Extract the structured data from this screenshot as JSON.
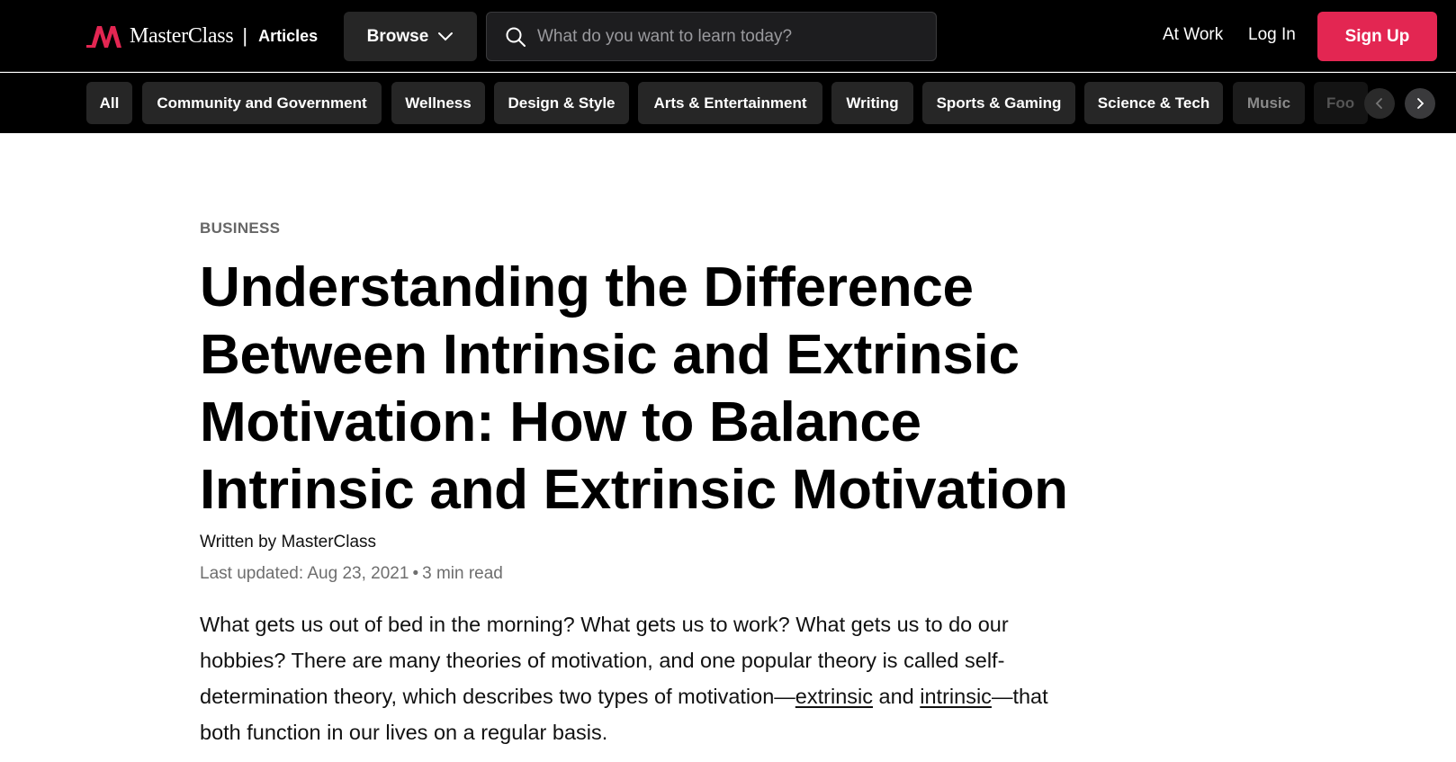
{
  "header": {
    "brand_name": "MasterClass",
    "brand_separator": "|",
    "section_label": "Articles",
    "browse_label": "Browse",
    "search_placeholder": "What do you want to learn today?",
    "at_work_label": "At Work",
    "login_label": "Log In",
    "signup_label": "Sign Up"
  },
  "categories": [
    {
      "label": "All"
    },
    {
      "label": "Community and Government"
    },
    {
      "label": "Wellness"
    },
    {
      "label": "Design & Style"
    },
    {
      "label": "Arts & Entertainment"
    },
    {
      "label": "Writing"
    },
    {
      "label": "Sports & Gaming"
    },
    {
      "label": "Science & Tech"
    },
    {
      "label": "Music"
    },
    {
      "label": "Foo"
    }
  ],
  "article": {
    "category": "BUSINESS",
    "title": "Understanding the Difference Between Intrinsic and Extrinsic Motivation: How to Balance Intrinsic and Extrinsic Motivation",
    "byline": "Written by MasterClass",
    "last_updated": "Last updated: Aug 23, 2021",
    "meta_separator": "•",
    "read_time": "3 min read",
    "body_intro": "What gets us out of bed in the morning? What gets us to work? What gets us to do our hobbies? There are many theories of motivation, and one popular theory is called self-determination theory, which describes two types of motivation—",
    "link_extrinsic": "extrinsic",
    "body_and": " and ",
    "link_intrinsic": "intrinsic",
    "body_outro": "—that both function in our lives on a regular basis."
  },
  "colors": {
    "brand_red": "#e32652",
    "nav_background": "#000000",
    "chip_background": "#262626"
  }
}
